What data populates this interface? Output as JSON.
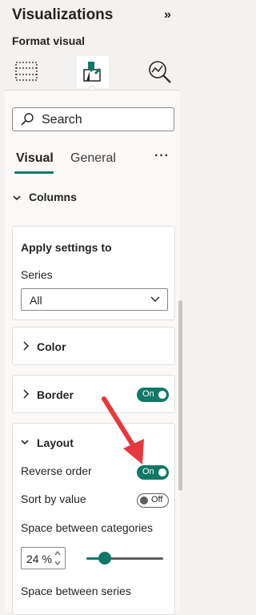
{
  "pane": {
    "title": "Visualizations",
    "collapse_icon": "double-chevron-right",
    "subtitle": "Format visual",
    "icons": [
      "build-visual-icon",
      "format-paintbrush-icon",
      "analytics-icon"
    ]
  },
  "search": {
    "placeholder": "Search"
  },
  "tabs": {
    "visual": "Visual",
    "general": "General",
    "more": "···"
  },
  "section": {
    "title": "Columns",
    "expanded": true
  },
  "apply_settings": {
    "title": "Apply settings to",
    "series_label": "Series",
    "series_value": "All"
  },
  "color_card": {
    "title": "Color"
  },
  "border_card": {
    "title": "Border",
    "toggle": "On"
  },
  "layout_card": {
    "title": "Layout",
    "reverse_order_label": "Reverse order",
    "reverse_order_toggle": "On",
    "sort_by_value_label": "Sort by value",
    "sort_by_value_toggle": "Off",
    "space_categories_label": "Space between categories",
    "space_categories_value": "24 %",
    "space_categories_slider_fraction": 0.24,
    "space_series_label": "Space between series"
  },
  "colors": {
    "accent": "#117865",
    "annotation": "#e8383d"
  }
}
